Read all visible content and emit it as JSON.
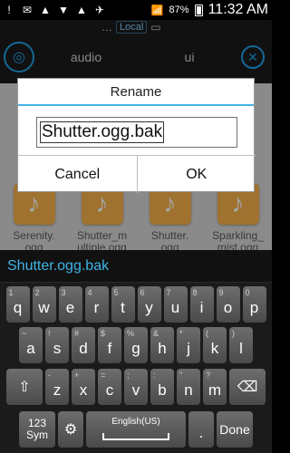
{
  "status_bar": {
    "left_icons": [
      "!",
      "✉",
      "▲",
      "▼",
      "▲",
      "✈"
    ],
    "battery_pct": "87%",
    "time": "11:32 AM"
  },
  "app": {
    "path": {
      "local_label": "Local"
    },
    "tabs": [
      "audio",
      "ui"
    ],
    "icons": {
      "left": "globe-icon",
      "right": "close-icon"
    }
  },
  "files": [
    {
      "name": "Serenity.\nogg"
    },
    {
      "name": "Shutter_m\nultiple.ogg"
    },
    {
      "name": "Shutter.\nogg"
    },
    {
      "name": "Sparkling_\nmist.ogg"
    }
  ],
  "dialog": {
    "title": "Rename",
    "input_value": "Shutter.ogg.bak",
    "cancel_label": "Cancel",
    "ok_label": "OK"
  },
  "suggestion": "Shutter.ogg.bak",
  "keyboard": {
    "row1": [
      {
        "k": "q",
        "s": "1"
      },
      {
        "k": "w",
        "s": "2"
      },
      {
        "k": "e",
        "s": "3"
      },
      {
        "k": "r",
        "s": "4"
      },
      {
        "k": "t",
        "s": "5"
      },
      {
        "k": "y",
        "s": "6"
      },
      {
        "k": "u",
        "s": "7"
      },
      {
        "k": "i",
        "s": "8"
      },
      {
        "k": "o",
        "s": "9"
      },
      {
        "k": "p",
        "s": "0"
      }
    ],
    "row2": [
      {
        "k": "a",
        "s": "~"
      },
      {
        "k": "s",
        "s": "!"
      },
      {
        "k": "d",
        "s": "#"
      },
      {
        "k": "f",
        "s": "$"
      },
      {
        "k": "g",
        "s": "%"
      },
      {
        "k": "h",
        "s": "&"
      },
      {
        "k": "j",
        "s": "*"
      },
      {
        "k": "k",
        "s": "("
      },
      {
        "k": "l",
        "s": ")"
      }
    ],
    "row3": [
      {
        "k": "z",
        "s": "-"
      },
      {
        "k": "x",
        "s": "+"
      },
      {
        "k": "c",
        "s": "="
      },
      {
        "k": "v",
        "s": ";"
      },
      {
        "k": "b",
        "s": ":"
      },
      {
        "k": "n",
        "s": "\""
      },
      {
        "k": "m",
        "s": "?"
      }
    ],
    "row4": {
      "sym_label": "123\nSym",
      "space_label": "English(US)",
      "period": ".",
      "done_label": "Done"
    }
  }
}
